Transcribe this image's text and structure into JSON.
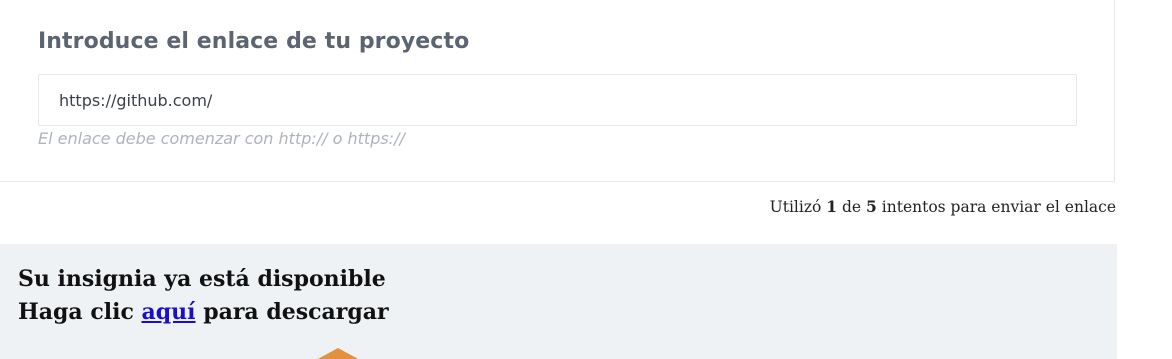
{
  "project_form": {
    "title": "Introduce el enlace de tu proyecto",
    "url_value": "https://github.com/",
    "hint": "El enlace debe comenzar con http:// o https://"
  },
  "attempts": {
    "prefix": "Utilizó",
    "used": "1",
    "of": "de",
    "total": "5",
    "suffix": "intentos para enviar el enlace"
  },
  "badge_notice": {
    "line1": "Su insignia ya está disponible",
    "line2_prefix": "Haga clic",
    "link_label": "aquí",
    "line2_suffix": "para descargar",
    "badge_color": "#e3913d"
  }
}
